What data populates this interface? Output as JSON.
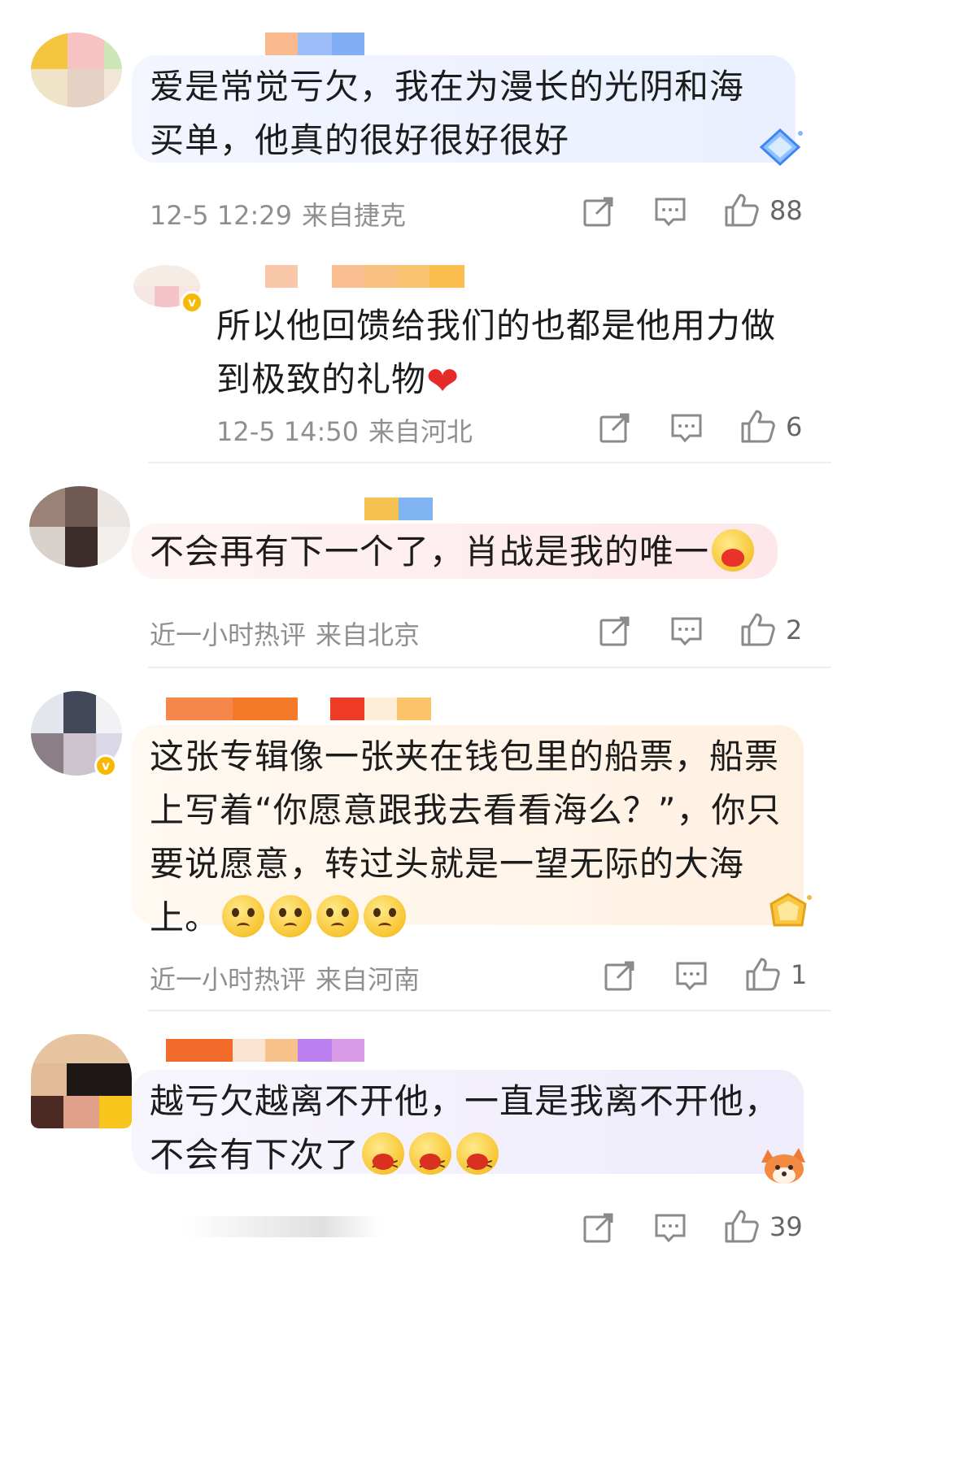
{
  "colors": {
    "text": "#1c1c1c",
    "meta": "#8f8f8f",
    "icon": "#8a8a8a",
    "divider": "#eeeeee",
    "bubble_blue": "#eef2ff",
    "bubble_pink": "#fdeff1",
    "bubble_cream": "#fff6ea",
    "bubble_lilac": "#f3f0fd",
    "vip_badge": "#f6b800"
  },
  "comments": [
    {
      "text": "爱是常觉亏欠，我在为漫长的光阴和海买单，他真的很好很好很好",
      "time": "12-5 12:29",
      "location": "来自捷克",
      "likes": "88",
      "decoration": "diamond-icon"
    },
    {
      "text": "所以他回馈给我们的也都是他用力做到极致的礼物",
      "emoji_after": "heart-icon",
      "time": "12-5 14:50",
      "location": "来自河北",
      "likes": "6",
      "verified": true,
      "verified_mark": "v"
    },
    {
      "text": "不会再有下一个了，肖战是我的唯一",
      "emoji_after": "hug-emoji",
      "time": "近一小时热评",
      "location": "来自北京",
      "likes": "2"
    },
    {
      "text": "这张专辑像一张夹在钱包里的船票，船票上写着“你愿意跟我去看看海么？”，你只要说愿意，转过头就是一望无际的大海上。",
      "emoji_after": "crying-emoji x4",
      "time": "近一小时热评",
      "location": "来自河南",
      "likes": "1",
      "verified": true,
      "verified_mark": "v",
      "decoration": "gem-icon"
    },
    {
      "text": "越亏欠越离不开他，一直是我离不开他，不会有下次了",
      "emoji_after": "wail-emoji x3",
      "likes": "39",
      "decoration": "fox-icon"
    }
  ]
}
